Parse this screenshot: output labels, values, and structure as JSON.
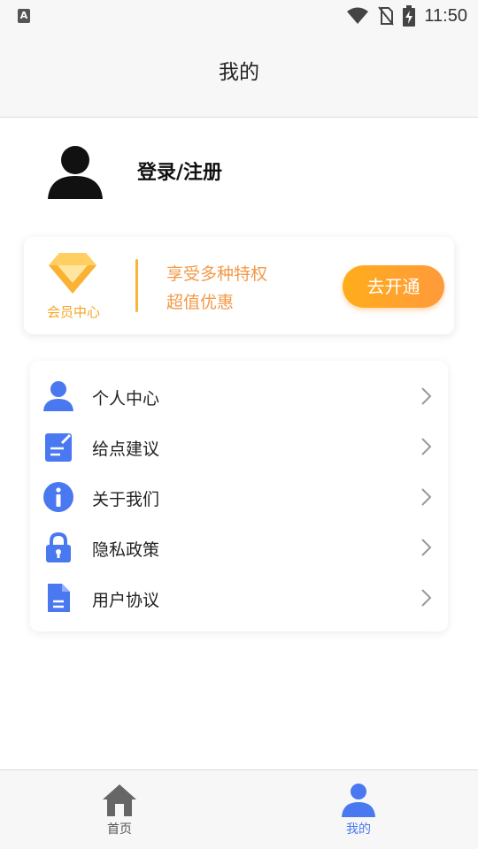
{
  "status_bar": {
    "time": "11:50",
    "left_icon": "a-icon",
    "icons": [
      "wifi-icon",
      "no-sim-icon",
      "battery-charging-icon"
    ]
  },
  "header": {
    "title": "我的"
  },
  "profile": {
    "avatar_icon": "user-avatar-icon",
    "login_label": "登录/注册"
  },
  "vip": {
    "icon": "diamond-icon",
    "center_label": "会员中心",
    "line1": "享受多种特权",
    "line2": "超值优惠",
    "button_label": "去开通",
    "accent_color": "#f5a524"
  },
  "menu": {
    "items": [
      {
        "label": "个人中心",
        "icon": "person-icon"
      },
      {
        "label": "给点建议",
        "icon": "feedback-icon"
      },
      {
        "label": "关于我们",
        "icon": "info-icon"
      },
      {
        "label": "隐私政策",
        "icon": "lock-icon"
      },
      {
        "label": "用户协议",
        "icon": "document-icon"
      }
    ],
    "icon_color": "#4a78f0"
  },
  "tab_bar": {
    "tabs": [
      {
        "label": "首页",
        "icon": "home-icon",
        "active": false
      },
      {
        "label": "我的",
        "icon": "person-icon",
        "active": true
      }
    ],
    "active_color": "#4a78f0"
  }
}
